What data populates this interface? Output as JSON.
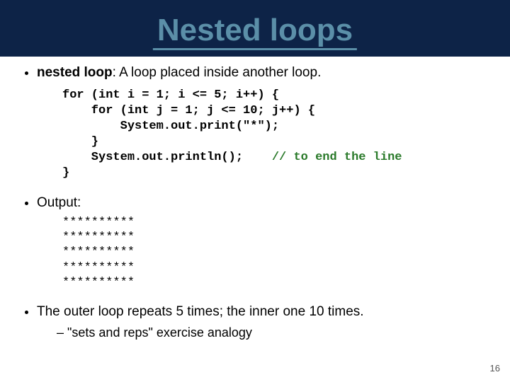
{
  "title": "Nested loops",
  "bullet1_term": "nested loop",
  "bullet1_rest": ": A loop placed inside another loop.",
  "code": "for (int i = 1; i <= 5; i++) {\n    for (int j = 1; j <= 10; j++) {\n        System.out.print(\"*\");\n    }\n    System.out.println();    ",
  "code_comment": "// to end the line",
  "code_tail": "\n}",
  "bullet2": "Output:",
  "output": "**********\n**********\n**********\n**********\n**********",
  "bullet3": "The outer loop repeats 5 times; the inner one 10 times.",
  "sub1": "\"sets and reps\" exercise analogy",
  "page_number": "16"
}
